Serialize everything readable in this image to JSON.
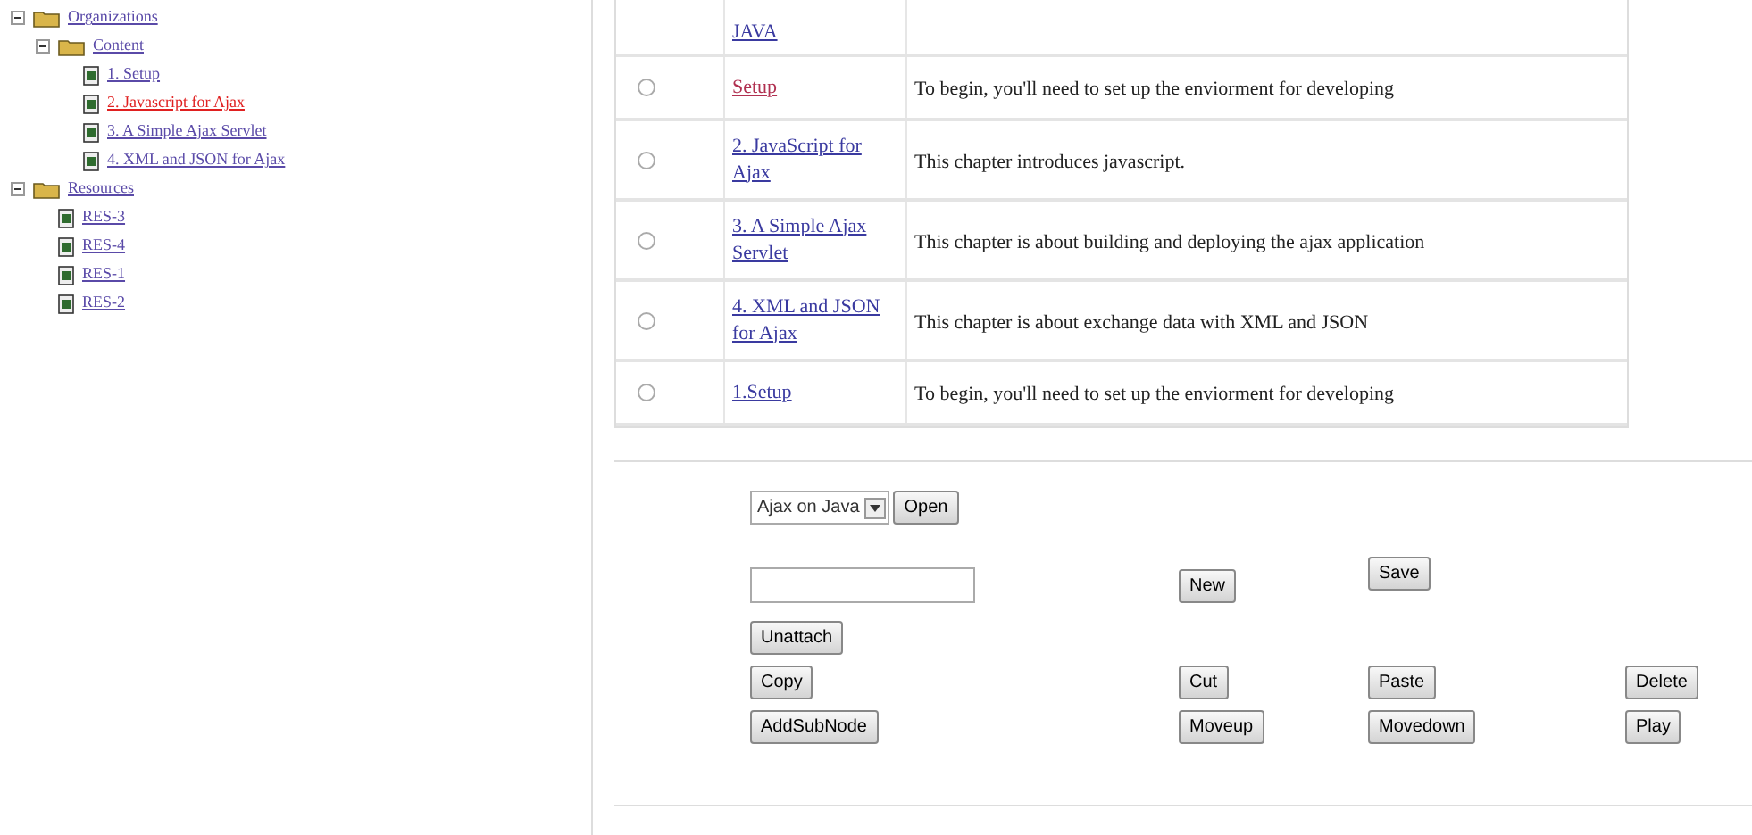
{
  "tree": [
    {
      "label": "Organizations",
      "kind": "folder",
      "selected": false,
      "children": [
        {
          "label": "Content",
          "kind": "folder",
          "selected": false,
          "children": [
            {
              "label": "1. Setup",
              "kind": "page",
              "selected": false
            },
            {
              "label": "2. Javascript for Ajax",
              "kind": "page",
              "selected": true
            },
            {
              "label": "3. A Simple Ajax Servlet",
              "kind": "page",
              "selected": false
            },
            {
              "label": "4. XML and JSON for Ajax",
              "kind": "page",
              "selected": false
            }
          ]
        }
      ]
    },
    {
      "label": "Resources",
      "kind": "folder",
      "selected": false,
      "children": [
        {
          "label": "RES-3",
          "kind": "page",
          "selected": false
        },
        {
          "label": "RES-4",
          "kind": "page",
          "selected": false
        },
        {
          "label": "RES-1",
          "kind": "page",
          "selected": false
        },
        {
          "label": "RES-2",
          "kind": "page",
          "selected": false
        }
      ]
    }
  ],
  "table": {
    "partial_row": {
      "title": "JAVA"
    },
    "rows": [
      {
        "title": "Setup",
        "description": "To begin, you'll need to set up the enviorment for developing",
        "selected": false,
        "visited": true
      },
      {
        "title": "2. JavaScript for Ajax",
        "description": "This chapter introduces javascript.",
        "selected": false,
        "visited": false
      },
      {
        "title": "3. A Simple Ajax Servlet",
        "description": "This chapter is about building and deploying the ajax application",
        "selected": false,
        "visited": false
      },
      {
        "title": "4. XML and JSON for Ajax",
        "description": "This chapter is about exchange data with XML and JSON",
        "selected": false,
        "visited": false
      },
      {
        "title": "1.Setup",
        "description": "To begin, you'll need to set up the enviorment for developing",
        "selected": false,
        "visited": false
      }
    ]
  },
  "form": {
    "select": {
      "value": "Ajax on Java"
    },
    "open_button": "Open",
    "new_button": "New",
    "save_button": "Save",
    "unattach_button": "Unattach",
    "row1": [
      "Copy",
      "Cut",
      "Paste",
      "Delete"
    ],
    "row2": [
      "AddSubNode",
      "Moveup",
      "Movedown",
      "Play"
    ]
  }
}
